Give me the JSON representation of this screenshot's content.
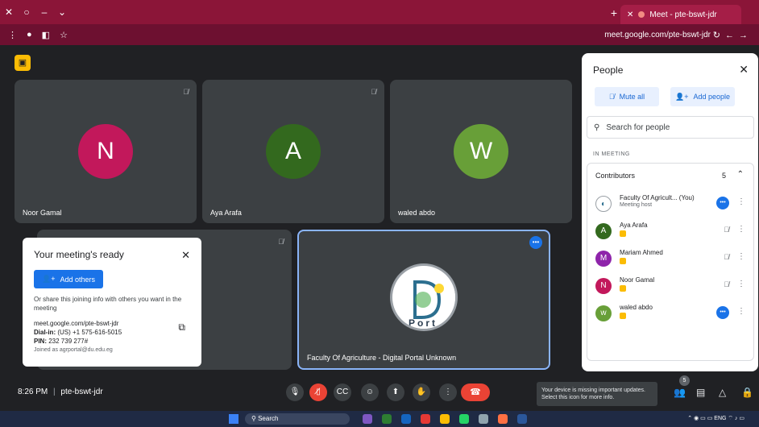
{
  "browser": {
    "tab_title": "Meet - pte-bswt-jdr",
    "url": "meet.google.com/pte-bswt-jdr"
  },
  "tiles": [
    {
      "name": "Noor Gamal",
      "initial": "N",
      "color": "#c2185b"
    },
    {
      "name": "Aya Arafa",
      "initial": "A",
      "color": "#33691e"
    },
    {
      "name": "waled abdo",
      "initial": "W",
      "color": "#689f38"
    }
  ],
  "presenter_tile": {
    "name": "Faculty Of Agriculture - Digital Portal Unknown",
    "logo_text": "Port"
  },
  "ready_card": {
    "title": "Your meeting's ready",
    "add_others": "Add others",
    "share_text": "Or share this joining info with others you want in the meeting",
    "link": "meet.google.com/pte-bswt-jdr",
    "dialin_label": "Dial-in:",
    "dialin": "(US) +1 575-616-5015",
    "pin_label": "PIN:",
    "pin": "232 739 277#",
    "joined_as": "Joined as agrportal@du.edu.eg"
  },
  "people": {
    "title": "People",
    "mute_all": "Mute all",
    "add_people": "Add people",
    "search_placeholder": "Search for people",
    "in_meeting": "IN MEETING",
    "group_label": "Contributors",
    "group_count": "5",
    "participants": [
      {
        "name": "Faculty Of Agricult...  (You)",
        "sub": "Meeting host",
        "initial": "",
        "color": "#ffffff"
      },
      {
        "name": "Aya Arafa",
        "sub": "",
        "initial": "A",
        "color": "#33691e"
      },
      {
        "name": "Mariam Ahmed",
        "sub": "",
        "initial": "M",
        "color": "#8e24aa"
      },
      {
        "name": "Noor Gamal",
        "sub": "",
        "initial": "N",
        "color": "#c2185b"
      },
      {
        "name": "waled abdo",
        "sub": "",
        "initial": "w",
        "color": "#689f38"
      }
    ]
  },
  "bottom": {
    "time": "8:26 PM",
    "separator": "|",
    "code": "pte-bswt-jdr",
    "tooltip": "Your device is missing important updates. Select this icon for more info.",
    "people_count": "5"
  },
  "taskbar": {
    "search": "Search",
    "lang": "ENG"
  }
}
